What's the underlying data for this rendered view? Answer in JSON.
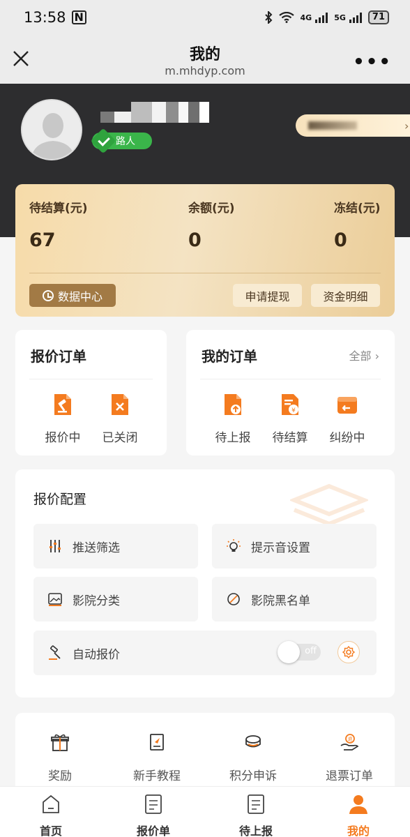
{
  "status_bar": {
    "time": "13:58",
    "nfc_label": "N",
    "net1": "4G",
    "net2": "5G",
    "battery": "71"
  },
  "nav": {
    "title": "我的",
    "url": "m.mhdyp.com",
    "more_label": "•••"
  },
  "profile": {
    "level_badge": "路人"
  },
  "wallet": {
    "pending_label": "待结算(元)",
    "pending_value": "67",
    "balance_label": "余额(元)",
    "balance_value": "0",
    "frozen_label": "冻结(元)",
    "frozen_value": "0",
    "data_center": "数据中心",
    "withdraw": "申请提现",
    "details": "资金明细"
  },
  "quote_orders": {
    "title": "报价订单",
    "items": [
      {
        "label": "报价中",
        "icon": "hammer-doc-icon"
      },
      {
        "label": "已关闭",
        "icon": "closed-doc-icon"
      }
    ]
  },
  "my_orders": {
    "title": "我的订单",
    "all_label": "全部 ›",
    "items": [
      {
        "label": "待上报",
        "icon": "upload-doc-icon"
      },
      {
        "label": "待结算",
        "icon": "settle-doc-icon"
      },
      {
        "label": "纠纷中",
        "icon": "dispute-box-icon"
      }
    ]
  },
  "config": {
    "title": "报价配置",
    "push_filter": "推送筛选",
    "sound": "提示音设置",
    "cinema_category": "影院分类",
    "cinema_blacklist": "影院黑名单",
    "auto_quote": "自动报价",
    "toggle_text": "off"
  },
  "tools": [
    {
      "label": "奖励",
      "icon": "gift-icon"
    },
    {
      "label": "新手教程",
      "icon": "book-icon"
    },
    {
      "label": "积分申诉",
      "icon": "coins-icon"
    },
    {
      "label": "退票订单",
      "icon": "refund-hand-icon"
    }
  ],
  "tabbar": {
    "home": "首页",
    "quotes": "报价单",
    "pending": "待上报",
    "mine": "我的"
  },
  "colors": {
    "accent": "#f47b1f",
    "gold": "#f4e3c3",
    "dark_header": "#2d2d2f",
    "badge_green": "#3ab54a"
  }
}
